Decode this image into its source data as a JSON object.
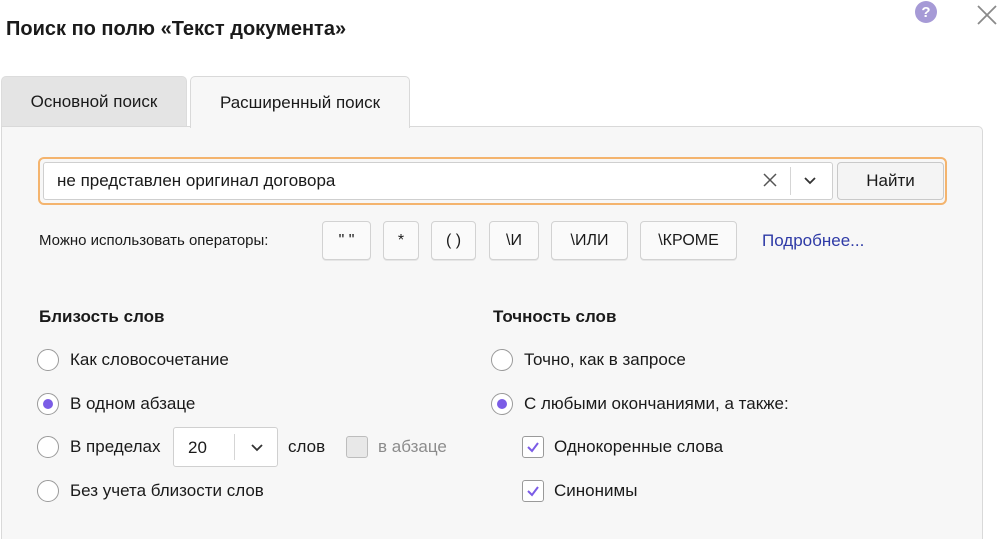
{
  "dialog": {
    "title": "Поиск по полю «Текст документа»",
    "help_icon": "question-circle-icon",
    "close_icon": "close-icon"
  },
  "tabs": [
    {
      "label": "Основной поиск",
      "active": false
    },
    {
      "label": "Расширенный поиск",
      "active": true
    }
  ],
  "search": {
    "value": "не представлен оригинал договора",
    "find_label": "Найти"
  },
  "operators": {
    "label": "Можно использовать операторы:",
    "items": [
      "\" \"",
      "*",
      "( )",
      "\\И",
      "\\ИЛИ",
      "\\КРОМЕ"
    ],
    "more_link": "Подробнее..."
  },
  "proximity": {
    "title": "Близость слов",
    "options": [
      {
        "label": "Как словосочетание",
        "selected": false
      },
      {
        "label": "В одном абзаце",
        "selected": true
      },
      {
        "label": "В пределах",
        "selected": false
      },
      {
        "label": "Без учета близости слов",
        "selected": false
      }
    ],
    "within_value": "20",
    "words_label": "слов",
    "in_paragraph_label": "в абзаце",
    "in_paragraph_checked": false
  },
  "accuracy": {
    "title": "Точность слов",
    "options": [
      {
        "label": "Точно, как в запросе",
        "selected": false
      },
      {
        "label": "С любыми окончаниями, а также:",
        "selected": true
      }
    ],
    "checks": [
      {
        "label": "Однокоренные слова",
        "checked": true
      },
      {
        "label": "Синонимы",
        "checked": true
      }
    ]
  },
  "colors": {
    "accent": "#7b5ce6",
    "focus_border": "#f4b46e",
    "link": "#2e3aa6",
    "help_icon_bg": "#a69ad6"
  }
}
